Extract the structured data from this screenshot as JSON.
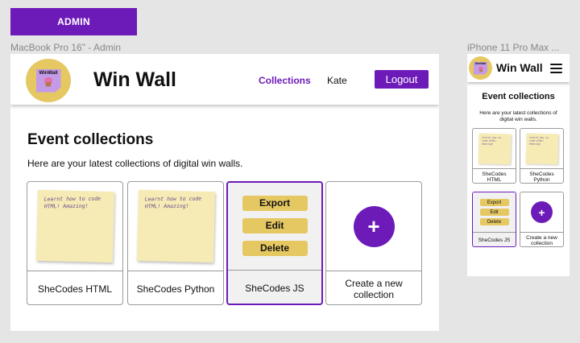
{
  "admin_label": "ADMIN",
  "frames": {
    "desktop_label": "MacBook Pro 16\" - Admin",
    "phone_label": "iPhone 11 Pro Max ..."
  },
  "brand": {
    "logo_text": "WinWall",
    "title": "Win Wall",
    "accent": "#6d1bb8",
    "yellow": "#e6c862",
    "note_color": "#f7ebb5"
  },
  "nav": {
    "collections": "Collections",
    "user": "Kate",
    "logout": "Logout"
  },
  "main": {
    "heading": "Event collections",
    "subtitle": "Here are your latest collections of digital win walls."
  },
  "collections": [
    {
      "name": "SheCodes HTML",
      "note": "Learnt how to code HTML! Amazing!",
      "state": "default"
    },
    {
      "name": "SheCodes Python",
      "note": "Learnt how to code HTML! Amazing!",
      "state": "default"
    },
    {
      "name": "SheCodes JS",
      "state": "hover",
      "actions": [
        "Export",
        "Edit",
        "Delete"
      ]
    }
  ],
  "create": {
    "label": "Create a new collection",
    "icon": "plus-icon"
  },
  "phone": {
    "collections": [
      {
        "name": "SheCodes HTML"
      },
      {
        "name": "SheCodes Python"
      },
      {
        "name": "SheCodes JS",
        "actions": [
          "Export",
          "Edit",
          "Delete"
        ]
      }
    ],
    "create_label": "Create a new collection"
  }
}
